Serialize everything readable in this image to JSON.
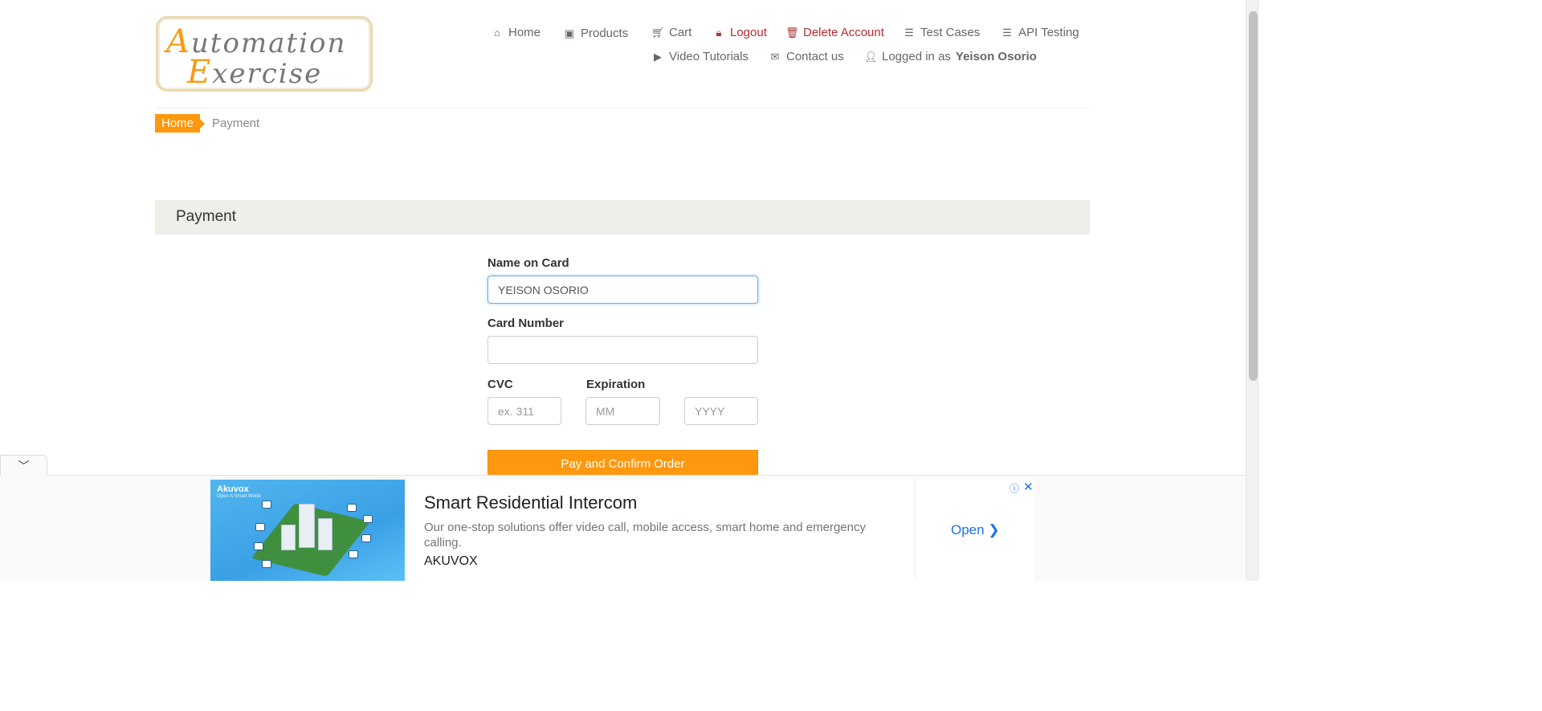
{
  "logo": {
    "line1_first": "A",
    "line1_rest": "utomation",
    "line2_first": "E",
    "line2_rest": "xercise"
  },
  "nav": {
    "home": "Home",
    "products": "Products",
    "cart": "Cart",
    "logout": "Logout",
    "delete_account": "Delete Account",
    "test_cases": "Test Cases",
    "api_testing": "API Testing",
    "video_tutorials": "Video Tutorials",
    "contact_us": "Contact us",
    "logged_in_prefix": "Logged in as",
    "logged_in_user": "Yeison Osorio"
  },
  "icons": {
    "home": "home-icon",
    "products": "briefcase-icon",
    "cart": "cart-icon",
    "logout": "lock-icon",
    "delete": "trash-icon",
    "test_cases": "list-icon",
    "api": "list-icon",
    "video": "youtube-icon",
    "contact": "envelope-icon",
    "user": "user-icon"
  },
  "breadcrumb": {
    "home": "Home",
    "current": "Payment"
  },
  "payment": {
    "heading": "Payment",
    "name_label": "Name on Card",
    "name_value": "YEISON OSORIO",
    "card_label": "Card Number",
    "card_value": "",
    "cvc_label": "CVC",
    "cvc_placeholder": "ex. 311",
    "expiration_label": "Expiration",
    "month_placeholder": "MM",
    "year_placeholder": "YYYY",
    "submit": "Pay and Confirm Order"
  },
  "ad": {
    "brand": "Akuvox",
    "brand_tagline": "Open A Smart World",
    "title": "Smart Residential Intercom",
    "description": "Our one-stop solutions offer video call, mobile access, smart home and emergency calling.",
    "advertiser": "AKUVOX",
    "cta": "Open"
  },
  "colors": {
    "accent": "#fe980f",
    "danger": "#b52e31",
    "link": "#1a73e8",
    "panel": "#efeee8"
  }
}
